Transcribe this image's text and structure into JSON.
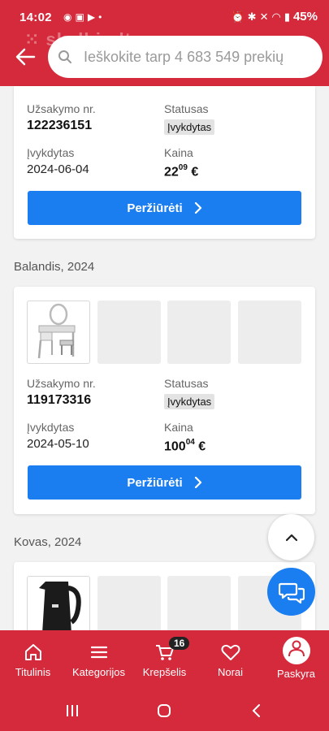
{
  "status_bar": {
    "time": "14:02",
    "battery": "45%"
  },
  "header": {
    "watermark": "skelbiu.lt",
    "search_placeholder": "Ieškokite tarp 4 683 549 prekių"
  },
  "orders": [
    {
      "order_label": "Užsakymo nr.",
      "order_number": "122236151",
      "status_label": "Statusas",
      "status": "Įvykdytas",
      "date_label": "Įvykdytas",
      "date": "2024-06-04",
      "price_label": "Kaina",
      "price_int": "22",
      "price_dec": "09",
      "currency": "€",
      "button": "Peržiūrėti"
    },
    {
      "section": "Balandis, 2024",
      "product_icon": "vanity-table-image",
      "order_label": "Užsakymo nr.",
      "order_number": "119173316",
      "status_label": "Statusas",
      "status": "Įvykdytas",
      "date_label": "Įvykdytas",
      "date": "2024-05-10",
      "price_label": "Kaina",
      "price_int": "100",
      "price_dec": "04",
      "currency": "€",
      "button": "Peržiūrėti"
    },
    {
      "section": "Kovas, 2024",
      "product_icon": "electric-kettle-image"
    }
  ],
  "bottom_nav": [
    {
      "label": "Titulinis",
      "icon": "home-icon"
    },
    {
      "label": "Kategorijos",
      "icon": "menu-icon"
    },
    {
      "label": "Krepšelis",
      "icon": "cart-icon",
      "badge": "16"
    },
    {
      "label": "Norai",
      "icon": "heart-icon"
    },
    {
      "label": "Paskyra",
      "icon": "user-icon"
    }
  ],
  "colors": {
    "brand_red": "#d42a3c",
    "button_blue": "#1a7ef0"
  }
}
